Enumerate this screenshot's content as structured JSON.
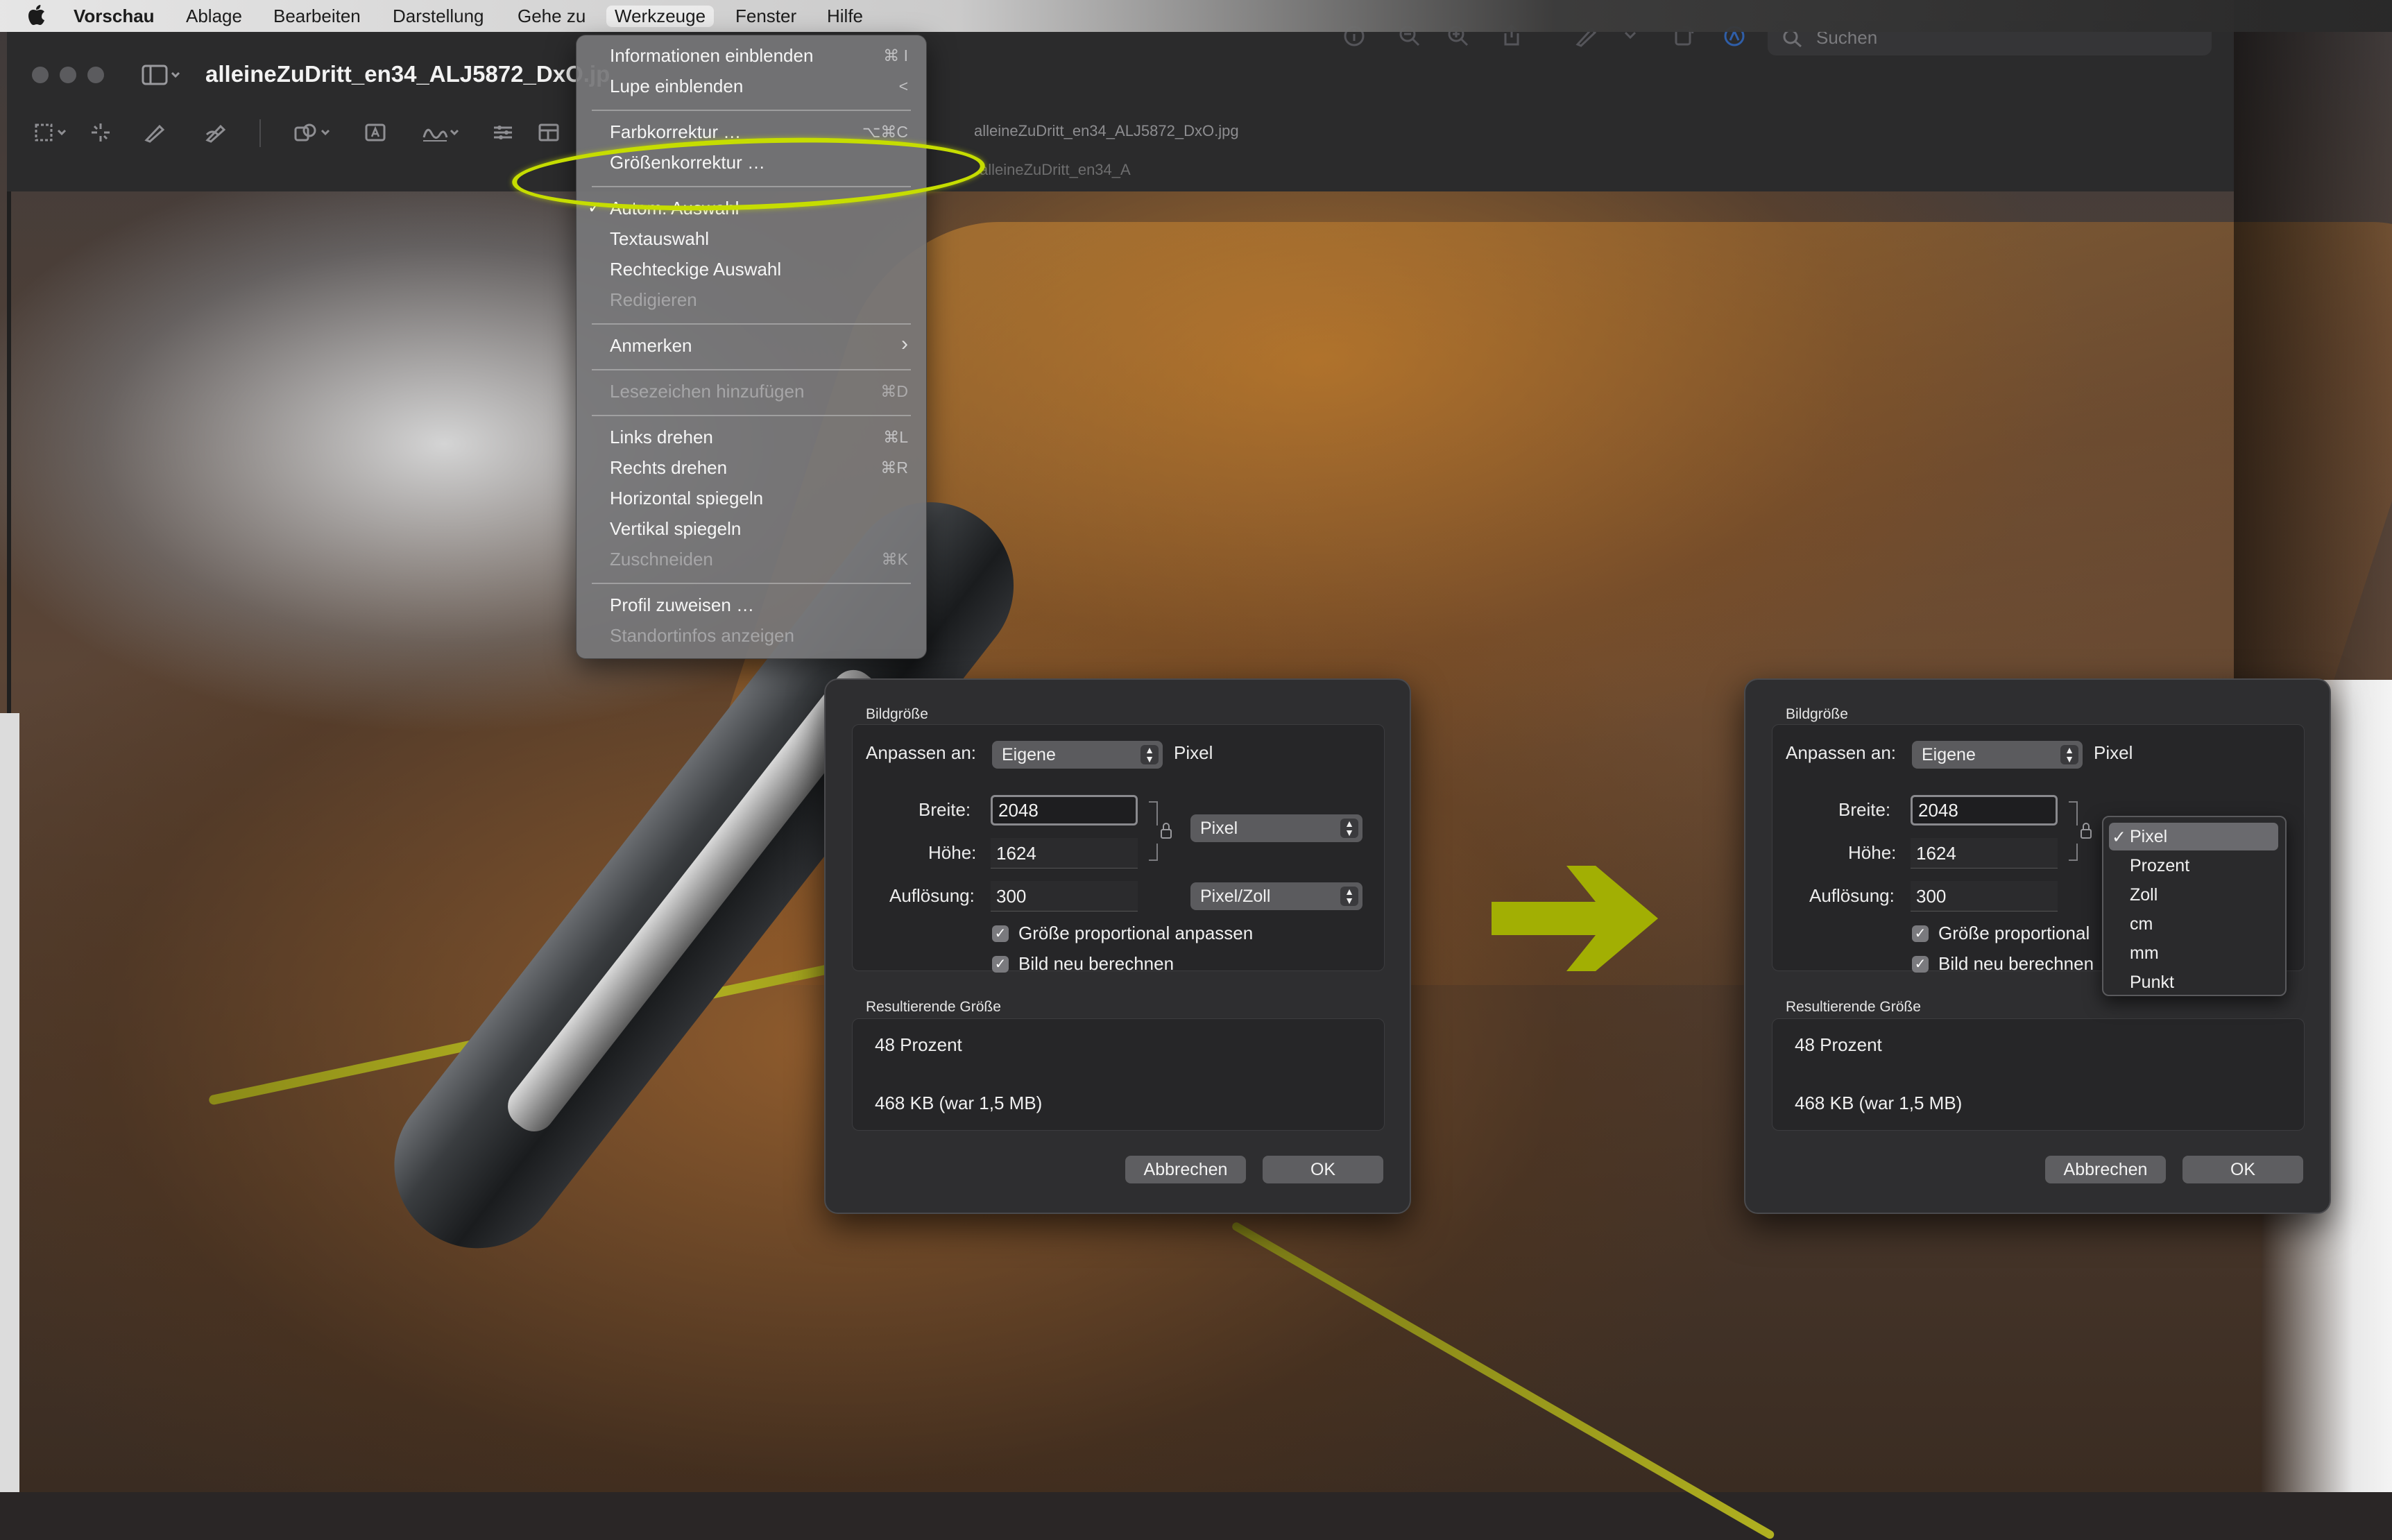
{
  "menubar": {
    "app": "Vorschau",
    "items": [
      "Ablage",
      "Bearbeiten",
      "Darstellung",
      "Gehe zu",
      "Werkzeuge",
      "Fenster",
      "Hilfe"
    ]
  },
  "window": {
    "title": "alleineZuDritt_en34_ALJ5872_DxO.jp",
    "doc_tab": "alleineZuDritt_en34_ALJ5872_DxO.jpg",
    "doc_tab_ghost": "alleineZuDritt_en34_A",
    "search_placeholder": "Suchen"
  },
  "tools_menu": {
    "items": [
      {
        "label": "Informationen einblenden",
        "shortcut": "⌘ I"
      },
      {
        "label": "Lupe einblenden",
        "shortcut": "<"
      },
      {
        "label": "Farbkorrektur …",
        "shortcut": "⌥⌘C"
      },
      {
        "label": "Größenkorrektur …",
        "shortcut": ""
      },
      {
        "label": "Autom. Auswahl",
        "checked": true
      },
      {
        "label": "Textauswahl"
      },
      {
        "label": "Rechteckige Auswahl"
      },
      {
        "label": "Redigieren",
        "disabled": true
      },
      {
        "label": "Anmerken",
        "submenu": "›"
      },
      {
        "label": "Lesezeichen hinzufügen",
        "shortcut": "⌘D",
        "disabled": true
      },
      {
        "label": "Links drehen",
        "shortcut": "⌘L"
      },
      {
        "label": "Rechts drehen",
        "shortcut": "⌘R"
      },
      {
        "label": "Horizontal spiegeln"
      },
      {
        "label": "Vertikal spiegeln"
      },
      {
        "label": "Zuschneiden",
        "shortcut": "⌘K",
        "disabled": true
      },
      {
        "label": "Profil zuweisen …"
      },
      {
        "label": "Standortinfos anzeigen",
        "disabled": true
      }
    ],
    "checkmark": "✓"
  },
  "dialog": {
    "section_size": "Bildgröße",
    "fit_label": "Anpassen an:",
    "fit_value": "Eigene",
    "fit_unit": "Pixel",
    "width_label": "Breite:",
    "width_value": "2048",
    "height_label": "Höhe:",
    "height_value": "1624",
    "resolution_label": "Auflösung:",
    "resolution_value": "300",
    "size_unit": "Pixel",
    "resolution_unit": "Pixel/Zoll",
    "scale_prop": "Größe proportional anpassen",
    "scale_prop_cut": "Größe proportional",
    "resample": "Bild neu berechnen",
    "resample_cut": "Bild neu berechnen",
    "result_title": "Resultierende Größe",
    "result_percent": "48 Prozent",
    "result_size": "468 KB (war 1,5 MB)",
    "cancel": "Abbrechen",
    "ok": "OK",
    "check": "✓"
  },
  "unit_options": [
    "Pixel",
    "Prozent",
    "Zoll",
    "cm",
    "mm",
    "Punkt"
  ],
  "unit_selected": "Pixel",
  "colors": {
    "highlight": "#c6dd00",
    "arrow": "#a8b800"
  }
}
